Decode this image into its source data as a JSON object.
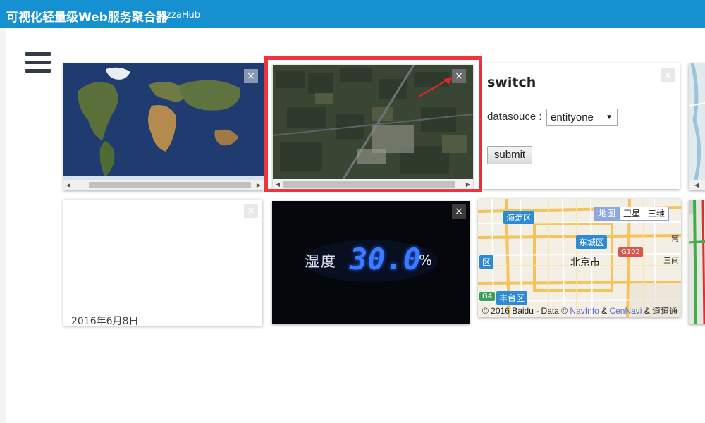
{
  "header": {
    "title": "可视化轻量级Web服务聚合器",
    "subtitle": "PizzaHub"
  },
  "menu": {
    "icon": "hamburger-menu-icon"
  },
  "widgets": {
    "world_map": {
      "close": "×"
    },
    "satellite": {
      "close": "×"
    },
    "switch_form": {
      "title": "switch",
      "datasource_label": "datasouce :",
      "datasource_value": "entityone",
      "submit_label": "submit",
      "close": "×"
    },
    "date_card": {
      "date": "2016年6月8日",
      "close": "×"
    },
    "humidity": {
      "label": "湿度",
      "value": "30.0",
      "unit": "%",
      "close": "×"
    },
    "baidu_map": {
      "buttons": [
        "地图",
        "卫星",
        "三维"
      ],
      "active_button": "地图",
      "places": [
        "海淀区",
        "东城区",
        "北京市",
        "丰台区",
        "G102",
        "G4",
        "区",
        "常",
        "三间"
      ],
      "copyright": {
        "prefix": "© 2016 Baidu - Data © ",
        "link1": "NavInfo",
        "amp": " & ",
        "link2": "CenNavi",
        "suffix": " & 道道通"
      }
    }
  },
  "colors": {
    "header": "#1591d1",
    "highlight": "#f2333b",
    "humidity_digits": "#2f6bff"
  }
}
